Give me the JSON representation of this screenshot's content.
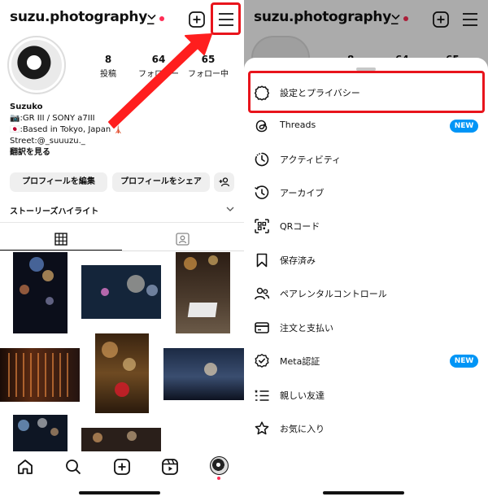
{
  "profile": {
    "username": "suzu.photography_",
    "stats": [
      {
        "value": "8",
        "label": "投稿"
      },
      {
        "value": "64",
        "label": "フォロワー"
      },
      {
        "value": "65",
        "label": "フォロー中"
      }
    ],
    "bio": {
      "name": "Suzuko",
      "line1": "📷:GR III / SONY a7III",
      "line2": "🇯🇵:Based in Tokyo, Japan 🗼",
      "line3": "Street:@_suuuzu._",
      "translate": "翻訳を見る"
    },
    "buttons": {
      "edit": "プロフィールを編集",
      "share": "プロフィールをシェア"
    },
    "highlights_title": "ストーリーズハイライト"
  },
  "menu": {
    "items": [
      {
        "label": "設定とプライバシー",
        "icon": "settings-gear-icon"
      },
      {
        "label": "Threads",
        "icon": "threads-icon",
        "badge": "NEW"
      },
      {
        "label": "アクティビティ",
        "icon": "activity-icon"
      },
      {
        "label": "アーカイブ",
        "icon": "archive-icon"
      },
      {
        "label": "QRコード",
        "icon": "qr-code-icon"
      },
      {
        "label": "保存済み",
        "icon": "bookmark-icon"
      },
      {
        "label": "ペアレンタルコントロール",
        "icon": "parental-control-icon"
      },
      {
        "label": "注文と支払い",
        "icon": "credit-card-icon"
      },
      {
        "label": "Meta認証",
        "icon": "verified-badge-icon",
        "badge": "NEW"
      },
      {
        "label": "親しい友達",
        "icon": "close-friends-list-icon"
      },
      {
        "label": "お気に入り",
        "icon": "star-icon"
      }
    ]
  },
  "colors": {
    "highlight": "#e8141c",
    "accent_blue": "#0095f6",
    "notification_dot": "#ff2d55"
  }
}
